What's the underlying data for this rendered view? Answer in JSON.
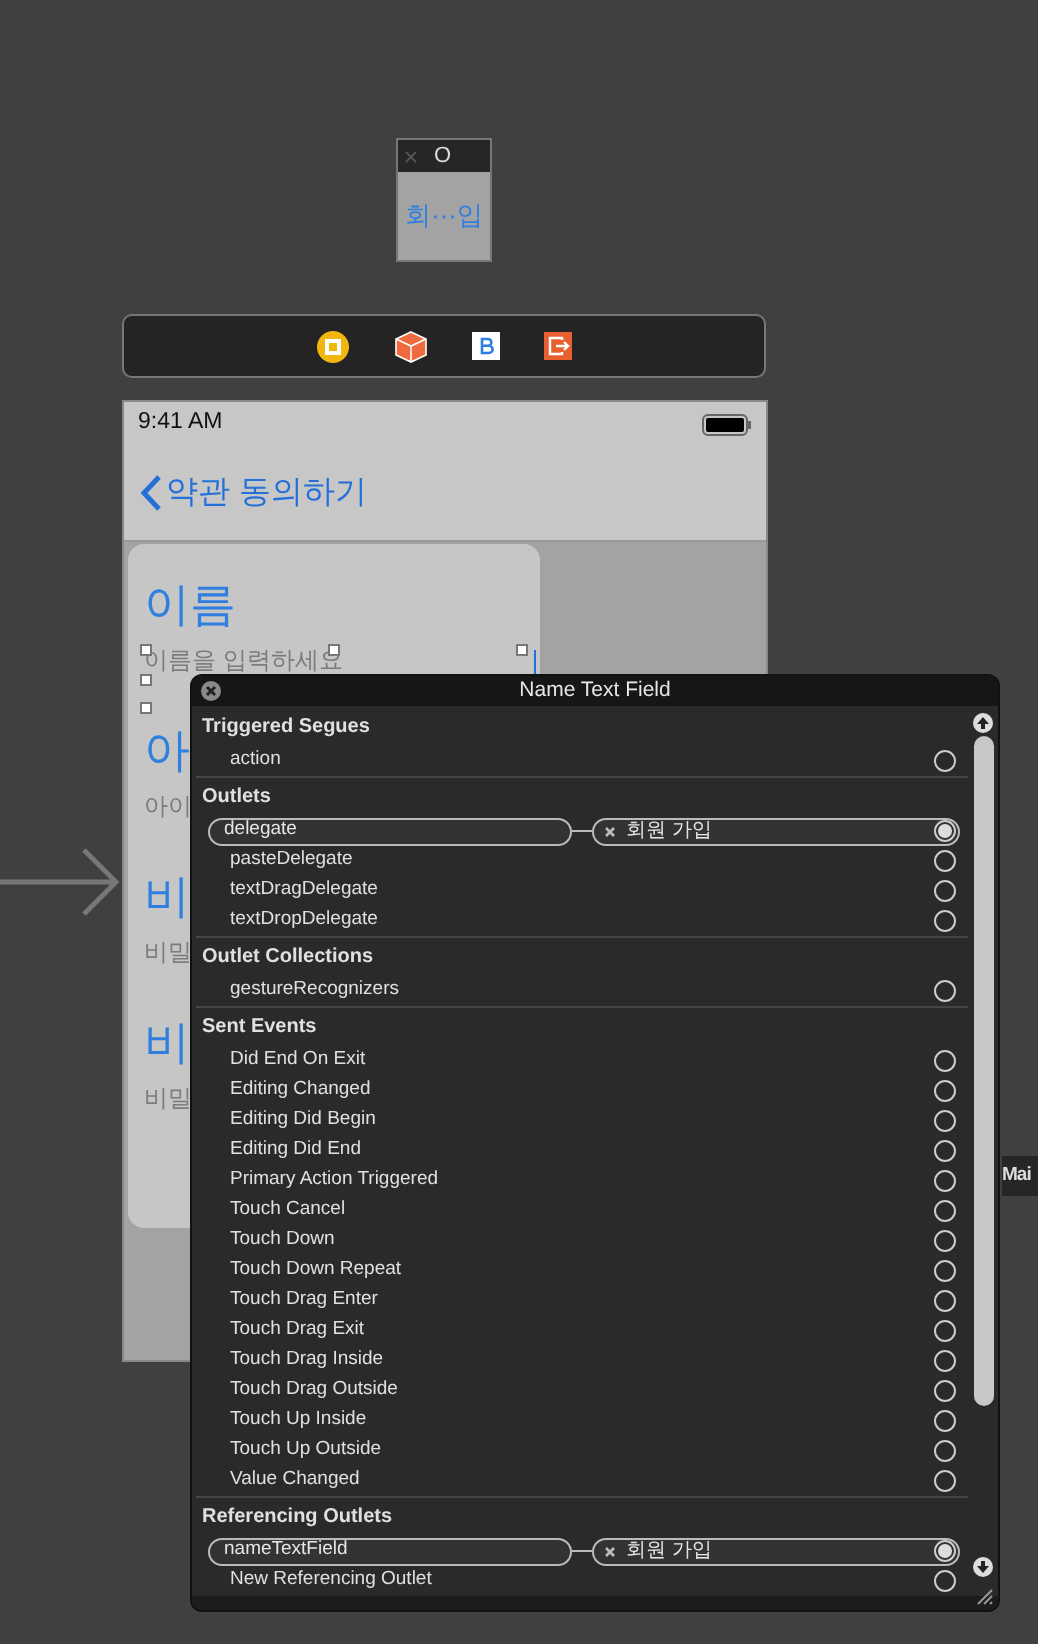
{
  "scene_dock": {
    "title": "O",
    "label": "회···입"
  },
  "phone": {
    "time": "9:41 AM",
    "back_title": "약관 동의하기",
    "fields": [
      {
        "label": "이름",
        "placeholder": "이름을 입력하세요"
      },
      {
        "label": "아",
        "placeholder": "아이"
      },
      {
        "label": "비",
        "placeholder": "비밀"
      },
      {
        "label": "비",
        "placeholder": "비밀"
      }
    ]
  },
  "side_label": "Mai",
  "inspector": {
    "title": "Name Text Field",
    "sections": [
      {
        "title": "Triggered Segues",
        "rows": [
          {
            "label": "action",
            "connected": false
          }
        ]
      },
      {
        "title": "Outlets",
        "rows": [
          {
            "label": "delegate",
            "connected": true,
            "target": "회원 가입"
          },
          {
            "label": "pasteDelegate",
            "connected": false
          },
          {
            "label": "textDragDelegate",
            "connected": false
          },
          {
            "label": "textDropDelegate",
            "connected": false
          }
        ]
      },
      {
        "title": "Outlet Collections",
        "rows": [
          {
            "label": "gestureRecognizers",
            "connected": false
          }
        ]
      },
      {
        "title": "Sent Events",
        "rows": [
          {
            "label": "Did End On Exit",
            "connected": false
          },
          {
            "label": "Editing Changed",
            "connected": false
          },
          {
            "label": "Editing Did Begin",
            "connected": false
          },
          {
            "label": "Editing Did End",
            "connected": false
          },
          {
            "label": "Primary Action Triggered",
            "connected": false
          },
          {
            "label": "Touch Cancel",
            "connected": false
          },
          {
            "label": "Touch Down",
            "connected": false
          },
          {
            "label": "Touch Down Repeat",
            "connected": false
          },
          {
            "label": "Touch Drag Enter",
            "connected": false
          },
          {
            "label": "Touch Drag Exit",
            "connected": false
          },
          {
            "label": "Touch Drag Inside",
            "connected": false
          },
          {
            "label": "Touch Drag Outside",
            "connected": false
          },
          {
            "label": "Touch Up Inside",
            "connected": false
          },
          {
            "label": "Touch Up Outside",
            "connected": false
          },
          {
            "label": "Value Changed",
            "connected": false
          }
        ]
      },
      {
        "title": "Referencing Outlets",
        "rows": [
          {
            "label": "nameTextField",
            "connected": true,
            "target": "회원 가입"
          },
          {
            "label": "New Referencing Outlet",
            "connected": false
          }
        ]
      }
    ]
  }
}
